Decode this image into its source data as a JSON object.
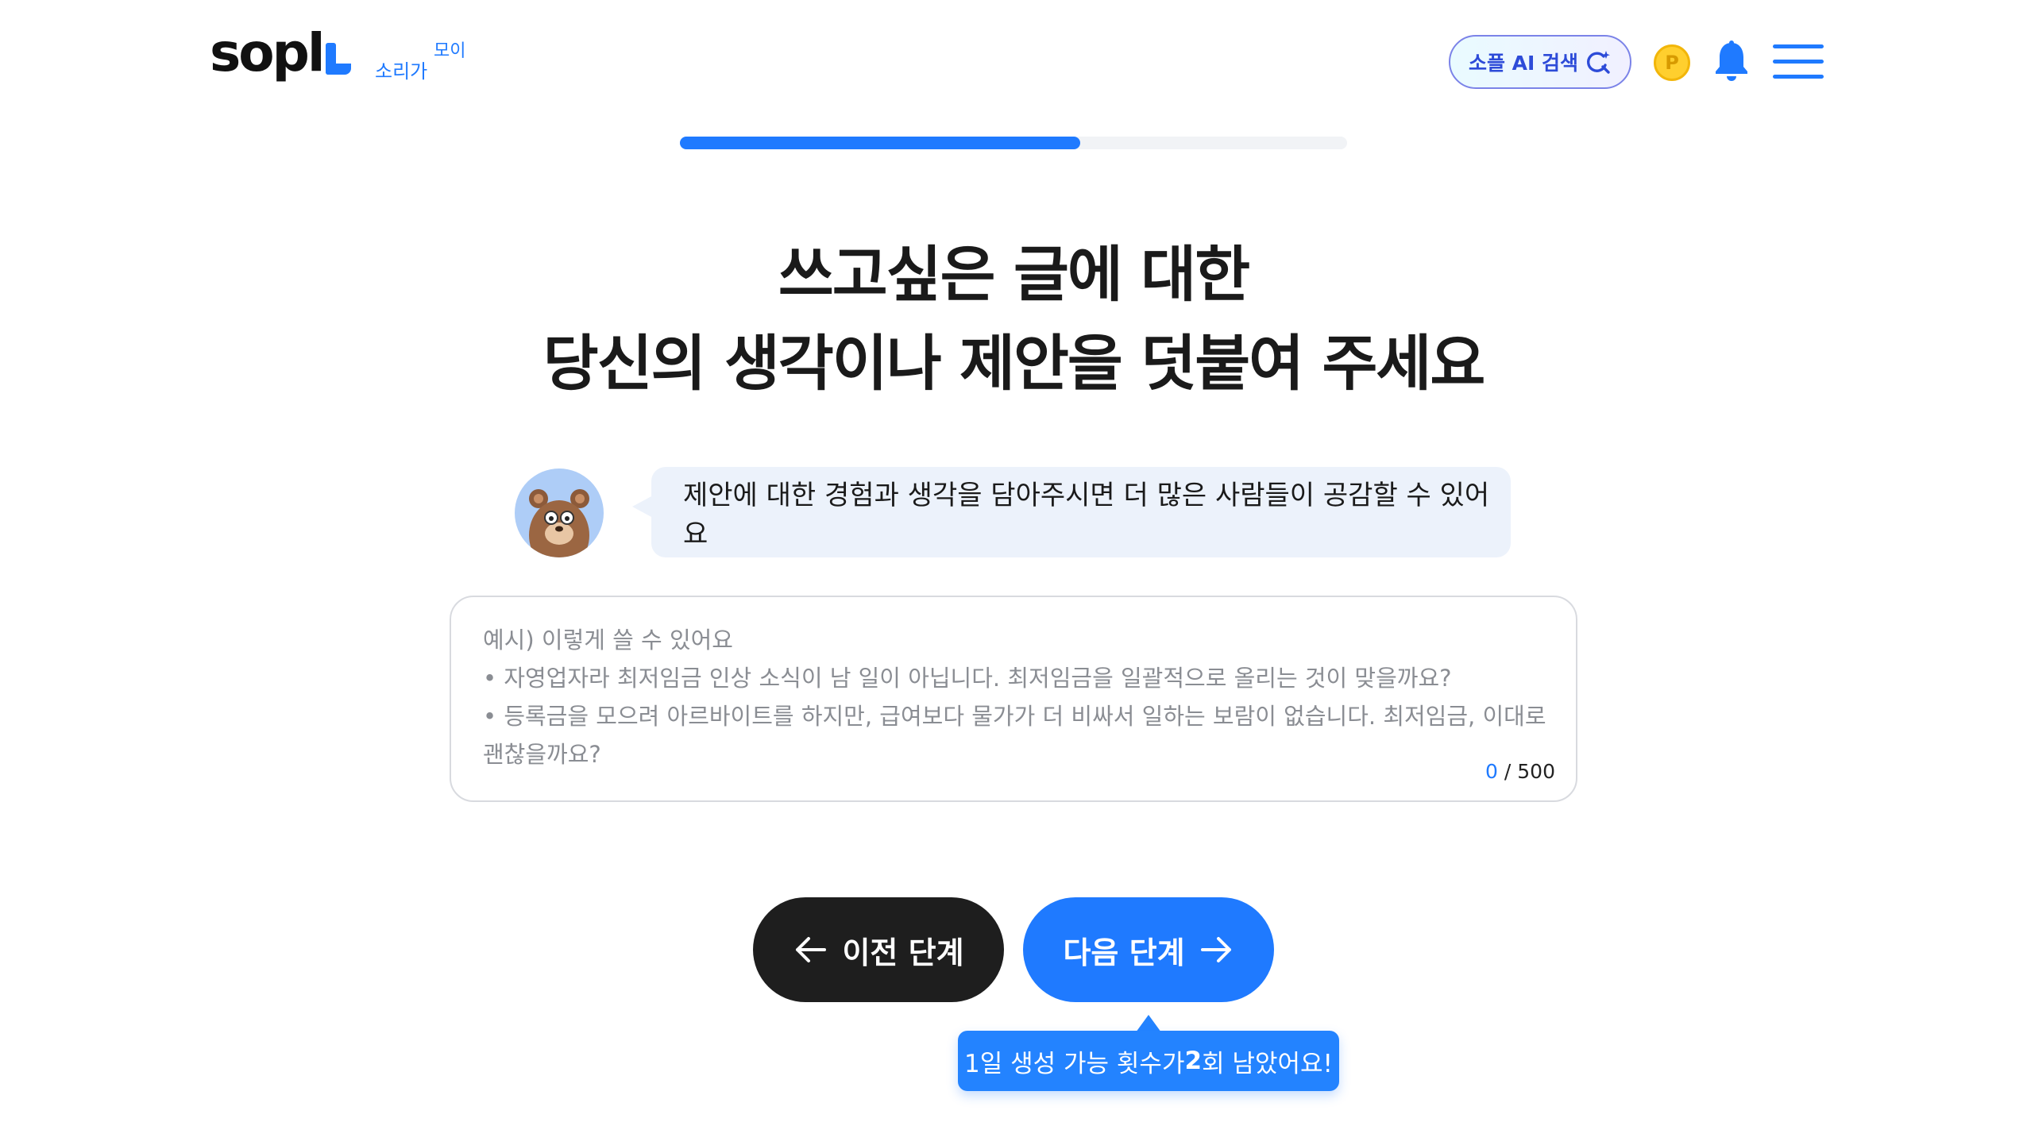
{
  "header": {
    "logo_text": "sopl",
    "tagline_1": "소리가",
    "tagline_2": "모이",
    "ai_search_label": "소플 AI 검색",
    "coin_label": "P"
  },
  "progress": {
    "value": 0.6
  },
  "heading": {
    "line1": "쓰고싶은 글에 대한",
    "line2": "당신의 생각이나 제안을 덧붙여 주세요"
  },
  "hint": {
    "text": "제안에 대한 경험과 생각을 담아주시면 더 많은 사람들이 공감할 수 있어요"
  },
  "input": {
    "value": "",
    "placeholder": "예시) 이렇게 쓸 수 있어요\n• 자영업자라 최저임금 인상 소식이 남 일이 아닙니다. 최저임금을 일괄적으로 올리는 것이 맞을까요?\n• 등록금을 모으려 아르바이트를 하지만, 급여보다 물가가 더 비싸서 일하는 보람이 없습니다. 최저임금, 이대로 괜찮을까요?",
    "count": "0",
    "max": "/ 500"
  },
  "buttons": {
    "prev_label": "이전 단계",
    "next_label": "다음 단계"
  },
  "tooltip": {
    "prefix": "1일 생성 가능 횟수가 ",
    "count": "2",
    "suffix": "회 남았어요!"
  },
  "colors": {
    "accent": "#1f7aff",
    "dark_button": "#1e1e1e",
    "bubble_bg": "#ecf2fb",
    "coin": "#ffcf2e"
  },
  "icons": {
    "ai_search": "search-sparkle-icon",
    "coin": "point-coin-icon",
    "bell": "bell-icon",
    "menu": "hamburger-menu-icon",
    "prev": "arrow-left-icon",
    "next": "arrow-right-icon",
    "avatar": "bear-mascot-avatar"
  }
}
